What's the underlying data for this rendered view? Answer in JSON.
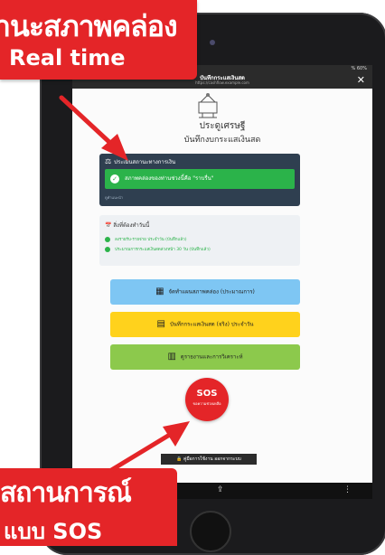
{
  "banner_top": {
    "line1": "านะสภาพคล่อง",
    "line2": "Real time"
  },
  "banner_bottom": {
    "line1": "สถานการณ์",
    "line2": "แบบ SOS"
  },
  "device": {
    "status_right": "% 60%",
    "window_title": "บันทึกกระแสเงินสด",
    "url": "https://cashflow.example.com",
    "close_glyph": "✕"
  },
  "app": {
    "title": "ประดูเศรษฐี",
    "subtitle": "บันทึกงบกระแสเงินสด",
    "status_card": {
      "heading": "ประเมินสถานะทางการเงิน",
      "message": "สภาพคล่องของท่านช่วงนี้คือ \"ราบรื่น\"",
      "note": "ดูคำแนะนำ"
    },
    "tasks": {
      "heading": "สิ่งที่ต้องทำวันนี้",
      "items": [
        "ลงรายรับ-รายจ่าย ประจำวัน (บันทึกแล้ว)",
        "ประมาณการกระแสเงินสดล่วงหน้า 30 วัน (บันทึกแล้ว)"
      ]
    },
    "buttons": {
      "forecast": "จัดทำแผนสภาพคล่อง (ประมาณการ)",
      "daily": "บันทึกกระแสเงินสด (จริง) ประจำวัน",
      "reports": "ดูรายงานและการวิเคราะห์"
    },
    "sos": {
      "label": "SOS",
      "sub": "ขอความช่วยเหลือ"
    },
    "footer_button": "คู่มือการใช้งาน ออกจากระบบ"
  },
  "colors": {
    "banner": "#e42528",
    "status_ok": "#2bb34a",
    "sos": "#e42528"
  }
}
